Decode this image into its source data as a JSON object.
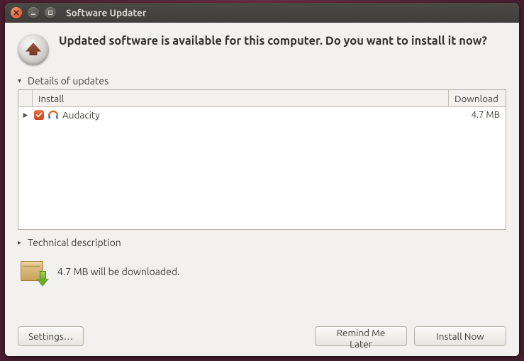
{
  "window": {
    "title": "Software Updater"
  },
  "headline": "Updated software is available for this computer. Do you want to install it now?",
  "details": {
    "label": "Details of updates",
    "columns": {
      "install": "Install",
      "download": "Download"
    },
    "items": [
      {
        "name": "Audacity",
        "size": "4.7 MB",
        "checked": true,
        "icon": "audacity-icon"
      }
    ]
  },
  "technical": {
    "label": "Technical description"
  },
  "summary": {
    "text": "4.7 MB will be downloaded."
  },
  "buttons": {
    "settings": "Settings…",
    "remind": "Remind Me Later",
    "install": "Install Now"
  }
}
